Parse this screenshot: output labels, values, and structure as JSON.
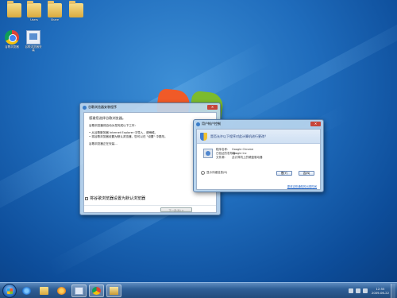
{
  "desktop": {
    "icons": [
      {
        "label": "",
        "kind": "folder"
      },
      {
        "label": "Users",
        "kind": "folder"
      },
      {
        "label": "Share",
        "kind": "folder"
      },
      {
        "label": "",
        "kind": "folder"
      },
      {
        "label": "谷歌浏览器",
        "kind": "chrome"
      },
      {
        "label": "谷歌浏览器安装",
        "kind": "setup"
      }
    ]
  },
  "setup_window": {
    "title": "谷歌浏览器安装程序",
    "heading": "感谢您选择谷歌浏览器。",
    "paragraphs": [
      "谷歌浏览器将自动为您完成以下工作：",
      "• 从谷歌服务器 Internet Explorer 中导入，请稍候。",
      "• 将谷歌浏览器设置为默认浏览器，您可以在 \"设置\" 中更改。",
      "谷歌浏览器正在安装..."
    ],
    "checkbox_label": "将谷歌浏览器设置为默认浏览器",
    "next_button": "下一步(N) >"
  },
  "uac_dialog": {
    "title": "用户帐户控制",
    "question": "是否允许以下程序对此计算机进行更改？",
    "program_label": "程序名称:",
    "program_value": "Google Chrome",
    "publisher_label": "已验证的发布者:",
    "publisher_value": "Google Inc",
    "origin_label": "文件源:",
    "origin_value": "此计算机上的硬盘驱动器",
    "details_label": "显示详细信息(D)",
    "yes_button": "是(Y)",
    "no_button": "否(N)",
    "settings_link": "更改这些通知的出现时间"
  },
  "taskbar": {
    "apps": [
      "internet-explorer",
      "explorer",
      "media-player",
      "setup-window",
      "chrome",
      "package"
    ],
    "clock_time": "12:55",
    "clock_date": "2009-06-22"
  }
}
